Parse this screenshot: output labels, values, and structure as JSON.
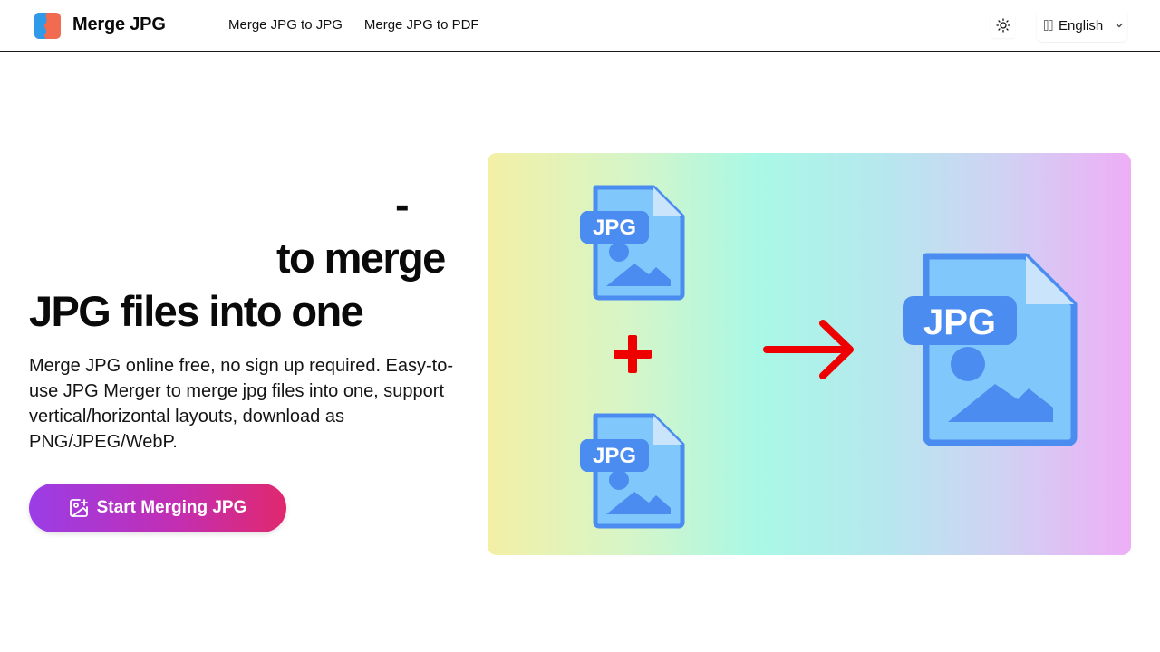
{
  "header": {
    "brand": "Merge JPG",
    "nav": [
      "Merge JPG to JPG",
      "Merge JPG to PDF"
    ],
    "language_label": "English"
  },
  "hero": {
    "title_line1": "-",
    "title_line2": "to merge",
    "title_line3": "JPG files into one",
    "description": "Merge JPG online free, no sign up required. Easy-to-use JPG Merger to merge jpg files into one, support vertical/horizontal layouts, download as PNG/JPEG/WebP.",
    "cta_label": "Start Merging JPG"
  },
  "illustration": {
    "file_label": "JPG"
  },
  "colors": {
    "file_blue": "#4a8cf0",
    "file_light": "#80c8fb",
    "arrow_red": "#ee0000",
    "cta_start": "#9a3de6",
    "cta_end": "#e0286e"
  },
  "icons": [
    "logo-icon",
    "sun-icon",
    "flag-icon",
    "chevron-down-icon",
    "image-plus-icon"
  ]
}
